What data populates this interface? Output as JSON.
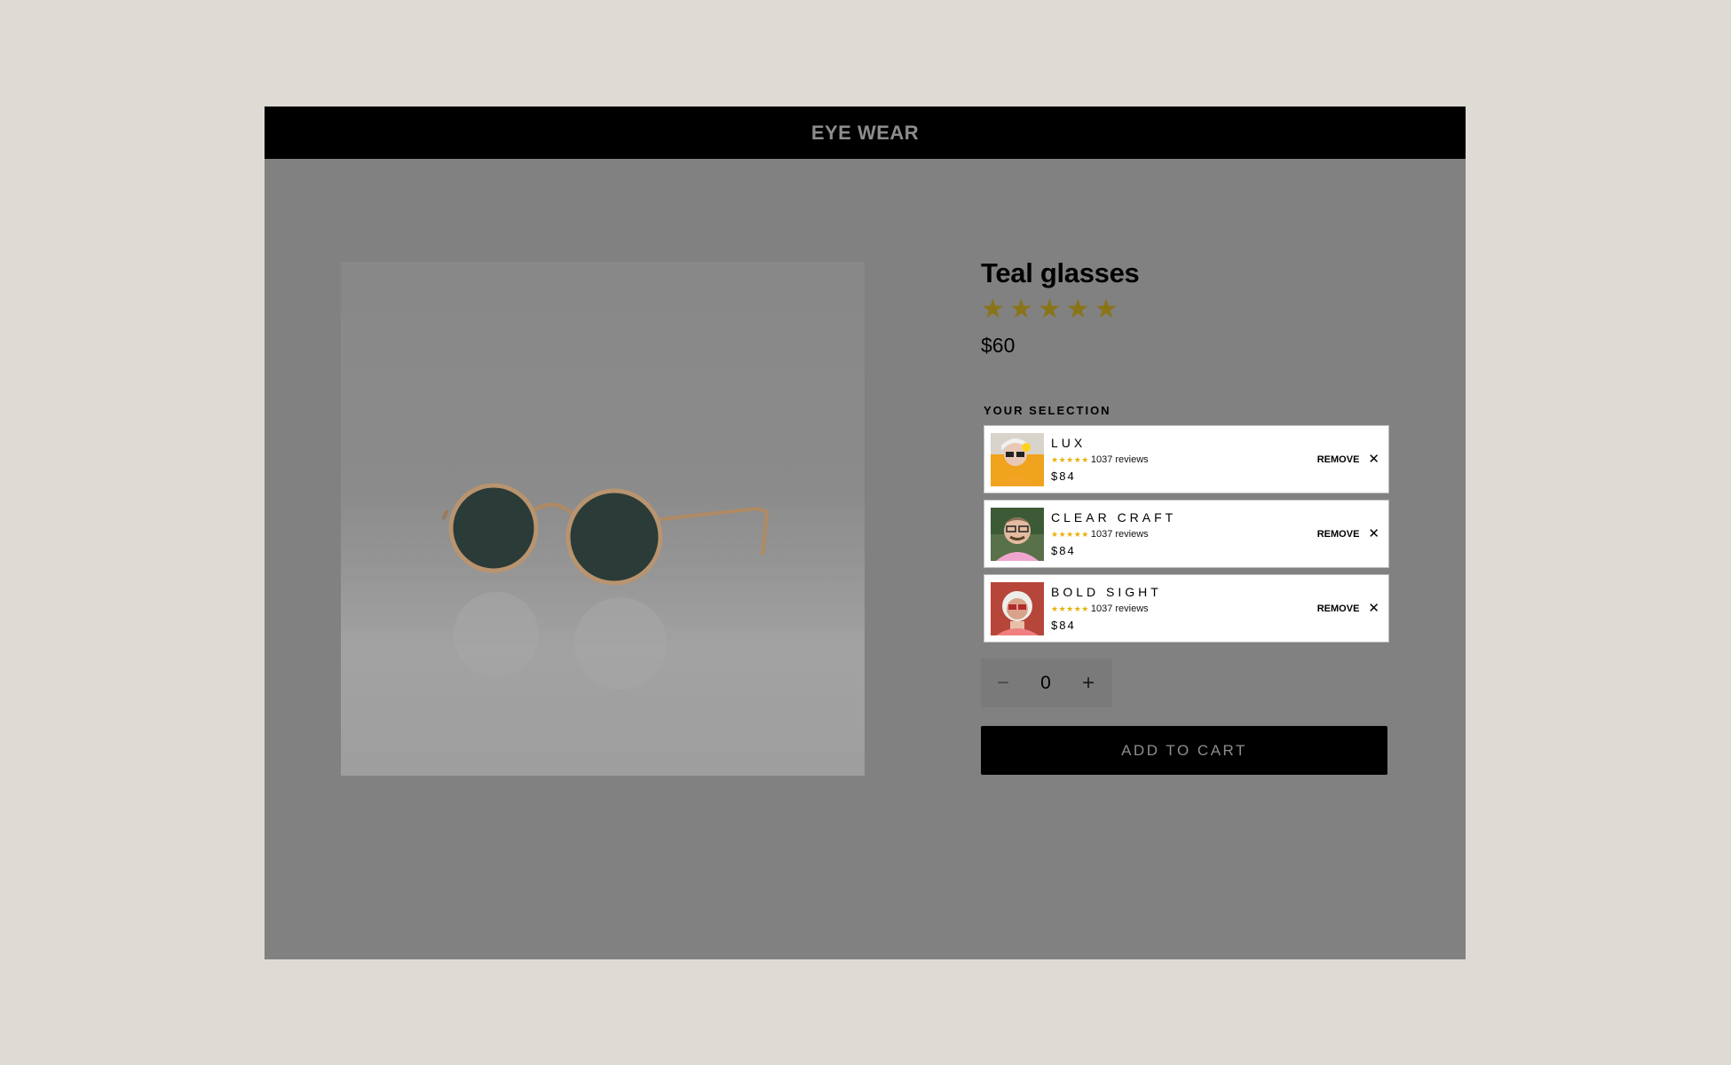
{
  "header": {
    "brand": "EYE WEAR"
  },
  "product": {
    "title": "Teal glasses",
    "rating_stars": 5,
    "price": "$60",
    "image": "teal-round-sunglasses-photo"
  },
  "selection": {
    "label": "YOUR SELECTION",
    "items": [
      {
        "name": "LUX",
        "reviews": "1037 reviews",
        "price": "$84",
        "stars": 5,
        "remove_label": "REMOVE",
        "thumb_bg": "#f0a31c"
      },
      {
        "name": "CLEAR CRAFT",
        "reviews": "1037 reviews",
        "price": "$84",
        "stars": 5,
        "remove_label": "REMOVE",
        "thumb_bg": "#3d5a36"
      },
      {
        "name": "BOLD SIGHT",
        "reviews": "1037 reviews",
        "price": "$84",
        "stars": 5,
        "remove_label": "REMOVE",
        "thumb_bg": "#b6453a"
      }
    ]
  },
  "quantity": {
    "minus_icon": "minus-icon",
    "value": "0",
    "plus_icon": "plus-icon"
  },
  "cart": {
    "label": "ADD TO CART"
  },
  "colors": {
    "page_bg": "#dedbd5",
    "overlay_bg": "#818181",
    "star_gold": "#8a7418",
    "mini_star": "#e8b10e",
    "button_bg": "#000000"
  }
}
